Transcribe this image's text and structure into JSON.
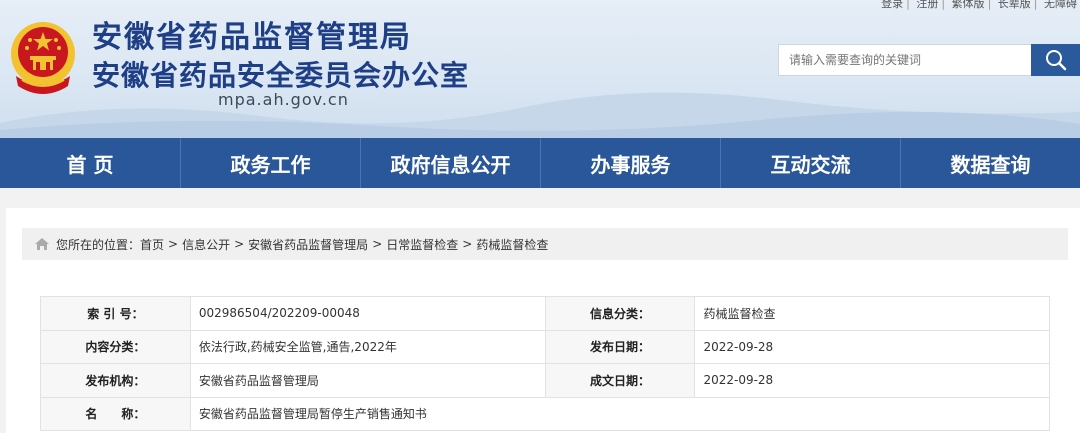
{
  "top_links": [
    "登录",
    "注册",
    "繁体版",
    "长辈版",
    "无障碍"
  ],
  "header": {
    "title_main": "安徽省药品监督管理局",
    "title_sub": "安徽省药品安全委员会办公室",
    "domain": "mpa.ah.gov.cn",
    "emblem_icon": "national-emblem-icon"
  },
  "search": {
    "placeholder": "请输入需要查询的关键词",
    "button_icon": "search-icon"
  },
  "nav": {
    "items": [
      "首 页",
      "政务工作",
      "政府信息公开",
      "办事服务",
      "互动交流",
      "数据查询"
    ]
  },
  "breadcrumb": {
    "prefix": "您所在的位置：",
    "items": [
      "首页",
      "信息公开",
      "安徽省药品监督管理局",
      "日常监督检查",
      "药械监督检查"
    ],
    "separator": ">"
  },
  "info": {
    "index_label": "索 引 号：",
    "index_value": "002986504/202209-00048",
    "category_label": "信息分类：",
    "category_value": "药械监督检查",
    "content_label": "内容分类：",
    "content_value": "依法行政,药械安全监管,通告,2022年",
    "publish_date_label": "发布日期：",
    "publish_date_value": "2022-09-28",
    "agency_label": "发布机构：",
    "agency_value": "安徽省药品监督管理局",
    "created_date_label": "成文日期：",
    "created_date_value": "2022-09-28",
    "name_label": "名　　称：",
    "name_value": "安徽省药品监督管理局暂停生产销售通知书"
  },
  "colors": {
    "brand_blue": "#2a579a",
    "title_blue": "#1e3e86",
    "emblem_red": "#c8171e",
    "emblem_gold": "#f2c230"
  }
}
